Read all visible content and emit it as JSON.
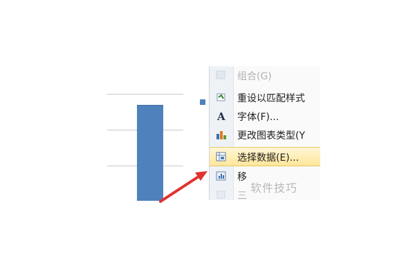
{
  "menu": {
    "items": [
      {
        "label": "组合(G)",
        "icon": "group-icon",
        "state": "faded"
      },
      {
        "label": "重设以匹配样式",
        "icon": "reset-style-icon",
        "state": "normal"
      },
      {
        "label": "字体(F)...",
        "icon": "font-icon",
        "state": "normal"
      },
      {
        "label": "更改图表类型(Y",
        "icon": "chart-type-icon",
        "state": "normal"
      },
      {
        "label": "选择数据(E)...",
        "icon": "select-data-icon",
        "state": "highlight"
      },
      {
        "label": "移",
        "icon": "move-chart-icon",
        "state": "normal"
      },
      {
        "label": "三",
        "icon": "3d-rotate-icon",
        "state": "faded"
      }
    ]
  },
  "watermark": "软件技巧",
  "colors": {
    "bar": "#4f81bd",
    "arrow": "#e0322f",
    "highlight": "#ffe69a"
  }
}
